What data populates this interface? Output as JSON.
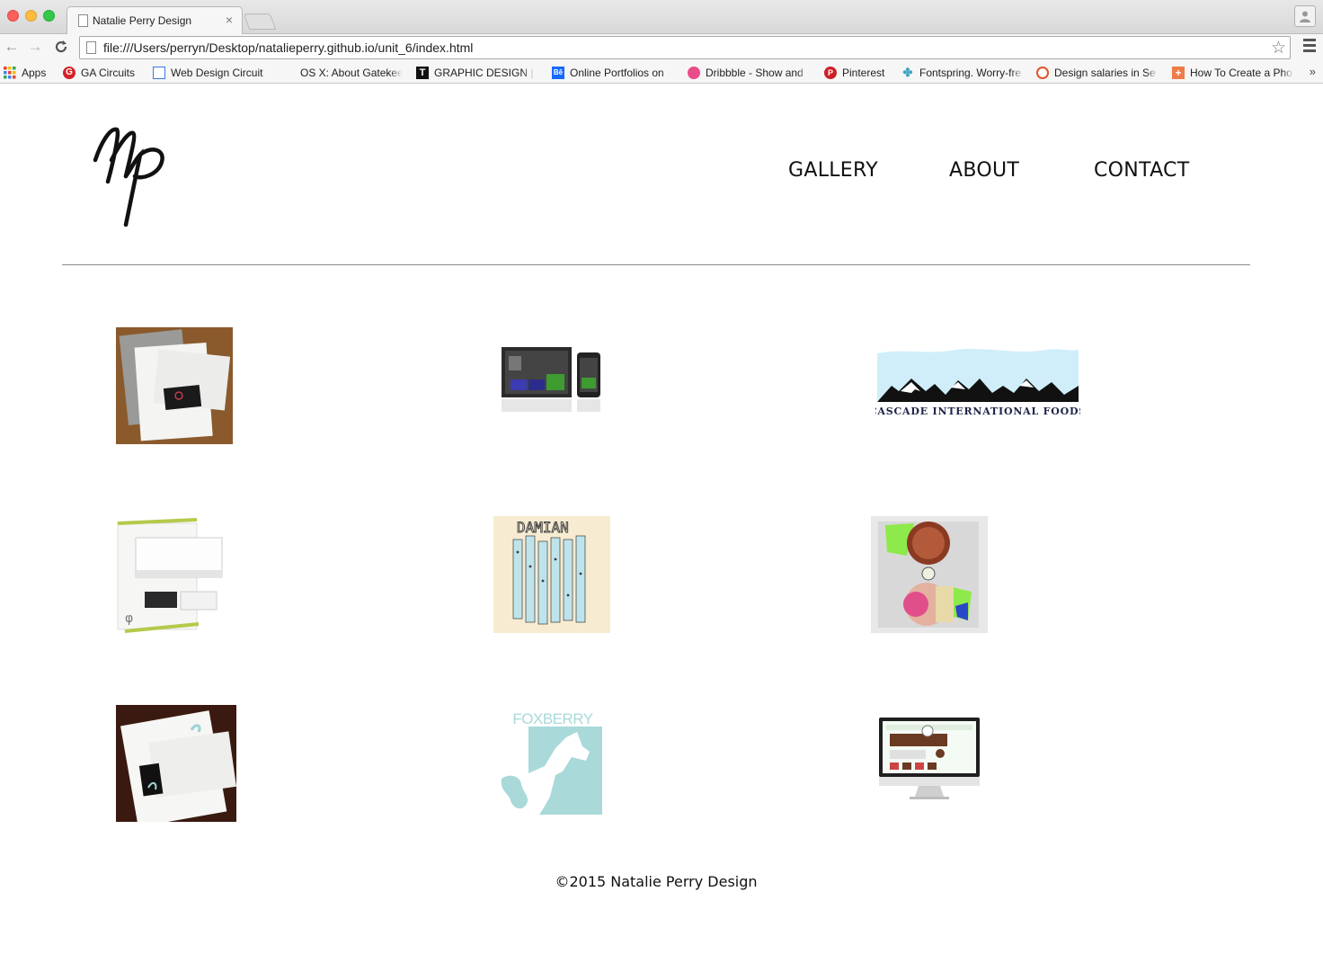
{
  "browser": {
    "tab_title": "Natalie Perry Design",
    "tab_close": "×",
    "url": "file:///Users/perryn/Desktop/natalieperry.github.io/unit_6/index.html",
    "back_glyph": "←",
    "forward_glyph": "→",
    "reload_glyph": "C",
    "star_glyph": "☆",
    "more_glyph": "»",
    "bookmarks": [
      {
        "label": "Apps",
        "icon": "apps-grid-icon"
      },
      {
        "label": "GA Circuits",
        "icon": "ga-icon"
      },
      {
        "label": "Web Design Circuit",
        "icon": "page-icon"
      },
      {
        "label": "OS X: About Gatekee",
        "icon": "apple-icon"
      },
      {
        "label": "GRAPHIC DESIGN |",
        "icon": "t-icon"
      },
      {
        "label": "Online Portfolios on",
        "icon": "behance-icon"
      },
      {
        "label": "Dribbble - Show and",
        "icon": "dribbble-icon"
      },
      {
        "label": "Pinterest",
        "icon": "pinterest-icon"
      },
      {
        "label": "Fontspring. Worry-fre",
        "icon": "fontspring-icon"
      },
      {
        "label": "Design salaries in Se",
        "icon": "target-icon"
      },
      {
        "label": "How To Create a Pho",
        "icon": "cross-icon"
      }
    ]
  },
  "header": {
    "logo_text": "Np",
    "nav": [
      "GALLERY",
      "ABOUT",
      "CONTACT"
    ]
  },
  "gallery": {
    "items": [
      {
        "name": "stationery-set-marble"
      },
      {
        "name": "website-devices-dark"
      },
      {
        "name": "cascade-logo",
        "text": "CASCADE INTERNATIONAL FOODS"
      },
      {
        "name": "stationery-set-green"
      },
      {
        "name": "damian-poster",
        "text": "DAMIAN"
      },
      {
        "name": "portrait-illustration"
      },
      {
        "name": "stationery-set-dark"
      },
      {
        "name": "foxberry-logo",
        "text": "FOXBERRY"
      },
      {
        "name": "website-imac"
      }
    ]
  },
  "footer": {
    "copyright": "©2015 Natalie Perry Design"
  },
  "colors": {
    "text": "#111111",
    "divider": "#8a8a8a",
    "foxberry_teal": "#a9d9d9",
    "cascade_navy": "#1c2447",
    "stationery_green": "#b6c94a"
  }
}
